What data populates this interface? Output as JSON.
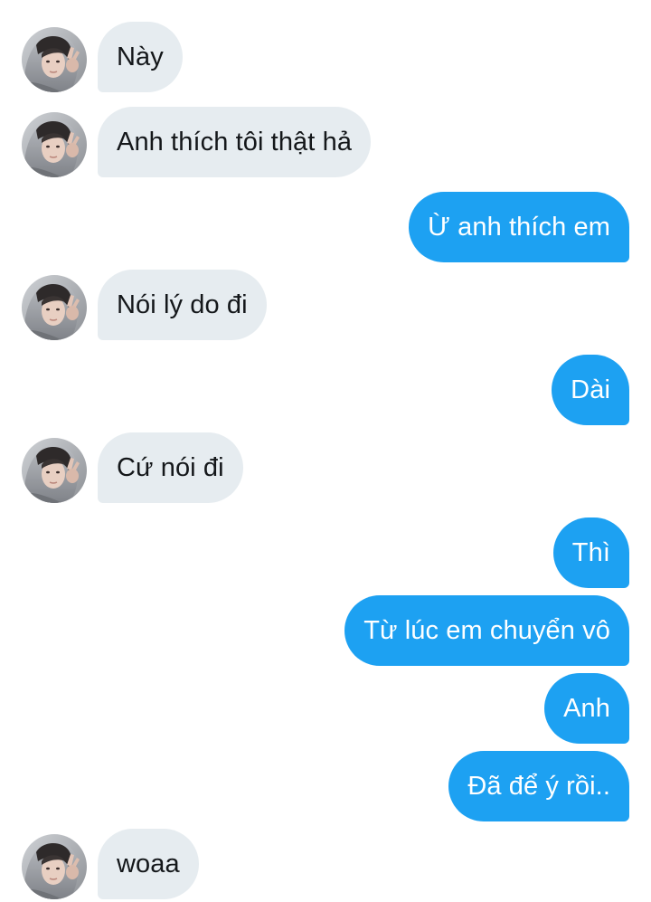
{
  "conversation": {
    "messages": [
      {
        "side": "in",
        "text": "Này"
      },
      {
        "side": "in",
        "text": "Anh thích tôi thật hả"
      },
      {
        "side": "out",
        "text": "Ừ anh thích em"
      },
      {
        "side": "in",
        "text": "Nói lý do đi"
      },
      {
        "side": "out",
        "text": "Dài"
      },
      {
        "side": "in",
        "text": "Cứ nói đi"
      },
      {
        "side": "out",
        "text": "Thì"
      },
      {
        "side": "out",
        "text": "Từ lúc em chuyển vô"
      },
      {
        "side": "out",
        "text": "Anh"
      },
      {
        "side": "out",
        "text": "Đã để ý rồi.."
      },
      {
        "side": "in",
        "text": "woaa"
      }
    ]
  },
  "theme": {
    "incoming_bubble": "#e6ecf0",
    "outgoing_bubble": "#1da1f2",
    "incoming_text": "#14171a",
    "outgoing_text": "#ffffff"
  }
}
